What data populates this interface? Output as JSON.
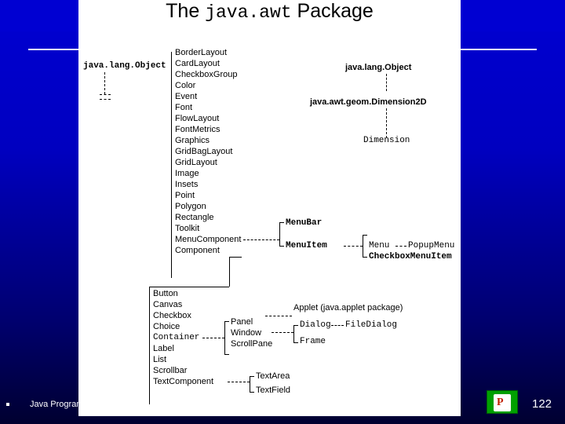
{
  "slide": {
    "title_prefix": "The ",
    "title_mono": "java.awt",
    "title_suffix": " Package",
    "footer_text": "Java Programming",
    "page_number": "122",
    "logo_mark": "P"
  },
  "diagram": {
    "roots": {
      "left_root": "java.lang.Object",
      "right_root": "java.lang.Object",
      "geom_class": "java.awt.geom.Dimension2D",
      "dimension": "Dimension"
    },
    "object_children": [
      "BorderLayout",
      "CardLayout",
      "CheckboxGroup",
      "Color",
      "Event",
      "Font",
      "FlowLayout",
      "FontMetrics",
      "Graphics",
      "GridBagLayout",
      "GridLayout",
      "Image",
      "Insets",
      "Point",
      "Polygon",
      "Rectangle",
      "Toolkit",
      "MenuComponent",
      "Component"
    ],
    "menu_branch": {
      "menubar": "MenuBar",
      "menuitem": "MenuItem",
      "menu": "Menu",
      "popupmenu": "PopupMenu",
      "checkboxmenuitem": "CheckboxMenuItem"
    },
    "component_children": [
      "Button",
      "Canvas",
      "Checkbox",
      "Choice",
      "Container",
      "Label",
      "List",
      "Scrollbar",
      "TextComponent"
    ],
    "container_children": [
      "Panel",
      "Window",
      "ScrollPane"
    ],
    "applet": "Applet (java.applet package)",
    "window_children": [
      "Dialog",
      "FileDialog",
      "Frame"
    ],
    "textcomponent_children": [
      "TextArea",
      "TextField"
    ]
  }
}
